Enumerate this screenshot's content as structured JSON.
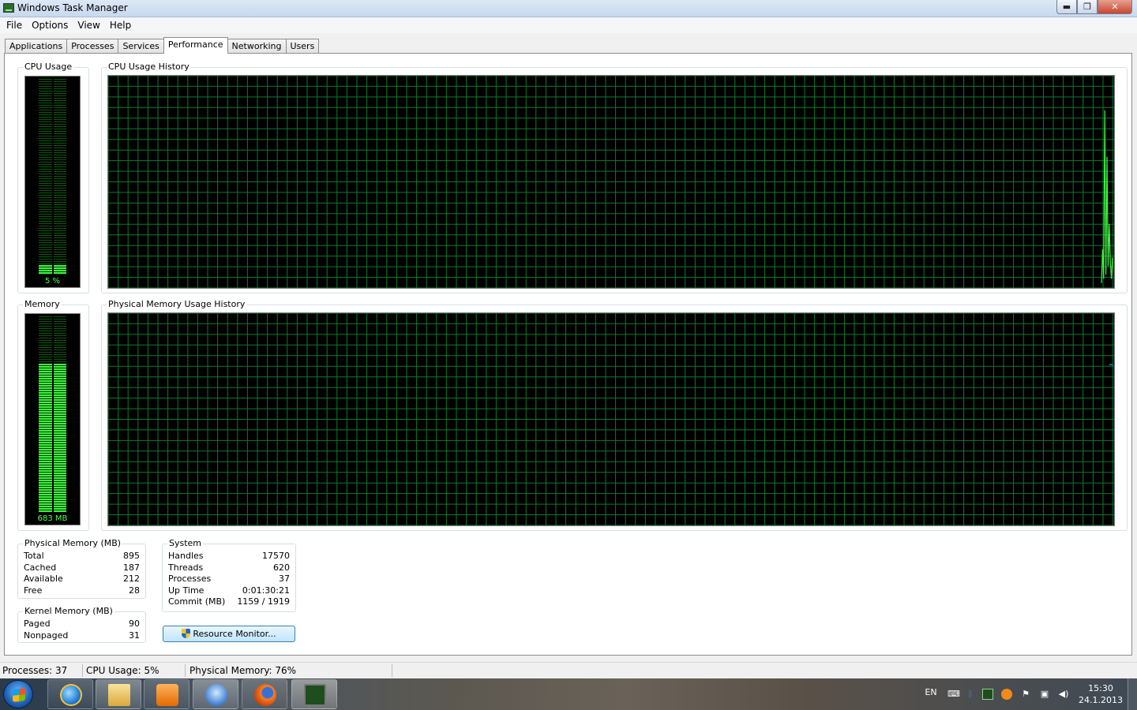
{
  "window": {
    "title": "Windows Task Manager",
    "minimize": "▬",
    "maximize": "❐",
    "close": "✕"
  },
  "menu": [
    "File",
    "Options",
    "View",
    "Help"
  ],
  "tabs": [
    {
      "label": "Applications",
      "active": false
    },
    {
      "label": "Processes",
      "active": false
    },
    {
      "label": "Services",
      "active": false
    },
    {
      "label": "Performance",
      "active": true
    },
    {
      "label": "Networking",
      "active": false
    },
    {
      "label": "Users",
      "active": false
    }
  ],
  "performance": {
    "cpu_usage": {
      "title": "CPU Usage",
      "value_label": "5 %",
      "percent": 5
    },
    "cpu_history": {
      "title": "CPU Usage History",
      "recent_values": [
        2,
        18,
        4,
        84,
        6,
        62,
        10,
        30,
        12,
        4,
        14
      ]
    },
    "memory": {
      "title": "Memory",
      "value_label": "683 MB",
      "percent": 76
    },
    "memory_history": {
      "title": "Physical Memory Usage History",
      "recent_values": [
        76,
        76,
        76,
        76
      ]
    },
    "physical_memory": {
      "title": "Physical Memory (MB)",
      "rows": [
        {
          "label": "Total",
          "value": "895"
        },
        {
          "label": "Cached",
          "value": "187"
        },
        {
          "label": "Available",
          "value": "212"
        },
        {
          "label": "Free",
          "value": "28"
        }
      ]
    },
    "kernel_memory": {
      "title": "Kernel Memory (MB)",
      "rows": [
        {
          "label": "Paged",
          "value": "90"
        },
        {
          "label": "Nonpaged",
          "value": "31"
        }
      ]
    },
    "system": {
      "title": "System",
      "rows": [
        {
          "label": "Handles",
          "value": "17570"
        },
        {
          "label": "Threads",
          "value": "620"
        },
        {
          "label": "Processes",
          "value": "37"
        },
        {
          "label": "Up Time",
          "value": "0:01:30:21"
        },
        {
          "label": "Commit (MB)",
          "value": "1159 / 1919"
        }
      ]
    },
    "resource_monitor_button": "Resource Monitor..."
  },
  "statusbar": {
    "processes": "Processes: 37",
    "cpu": "CPU Usage: 5%",
    "memory": "Physical Memory: 76%"
  },
  "taskbar": {
    "apps": [
      "windows-explorer",
      "internet-explorer",
      "file-explorer",
      "media-player",
      "connect-icon",
      "firefox",
      "task-manager"
    ],
    "tray": {
      "language": "EN",
      "time": "15:30",
      "date": "24.1.2013"
    }
  },
  "colors": {
    "graph_grid": "#0b7a2e",
    "cpu_line": "#3ef23e",
    "memory_line": "#2f8fff",
    "meter_fill": "#3ef23e"
  }
}
